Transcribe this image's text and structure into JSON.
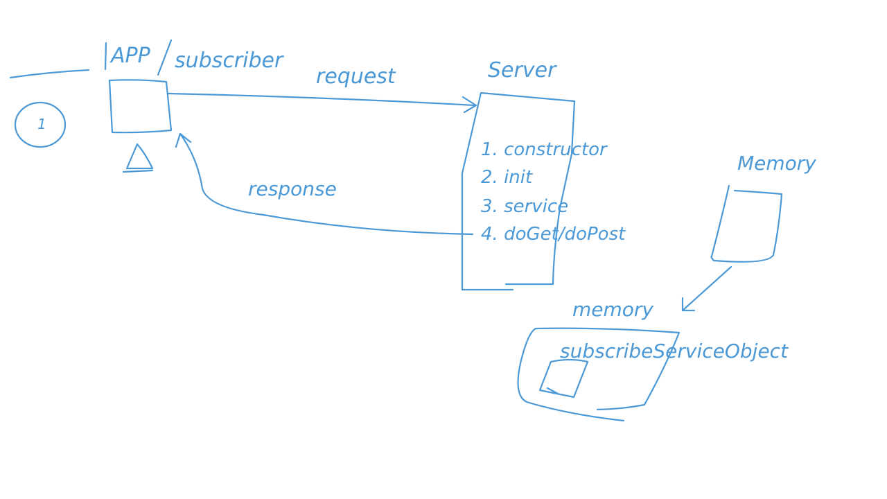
{
  "colors": {
    "ink": "#4a98d6",
    "background": "#ffffff"
  },
  "labels": {
    "step_number": "1",
    "app_title": "APP",
    "subscriber": "subscriber",
    "request": "request",
    "response": "response",
    "server": "Server",
    "memory_title": "Memory",
    "memory_lower": "memory",
    "object_label": "subscribeServiceObject"
  },
  "servlet_lifecycle": [
    "1. constructor",
    "2. init",
    "3. service",
    "4. doGet/doPost"
  ]
}
